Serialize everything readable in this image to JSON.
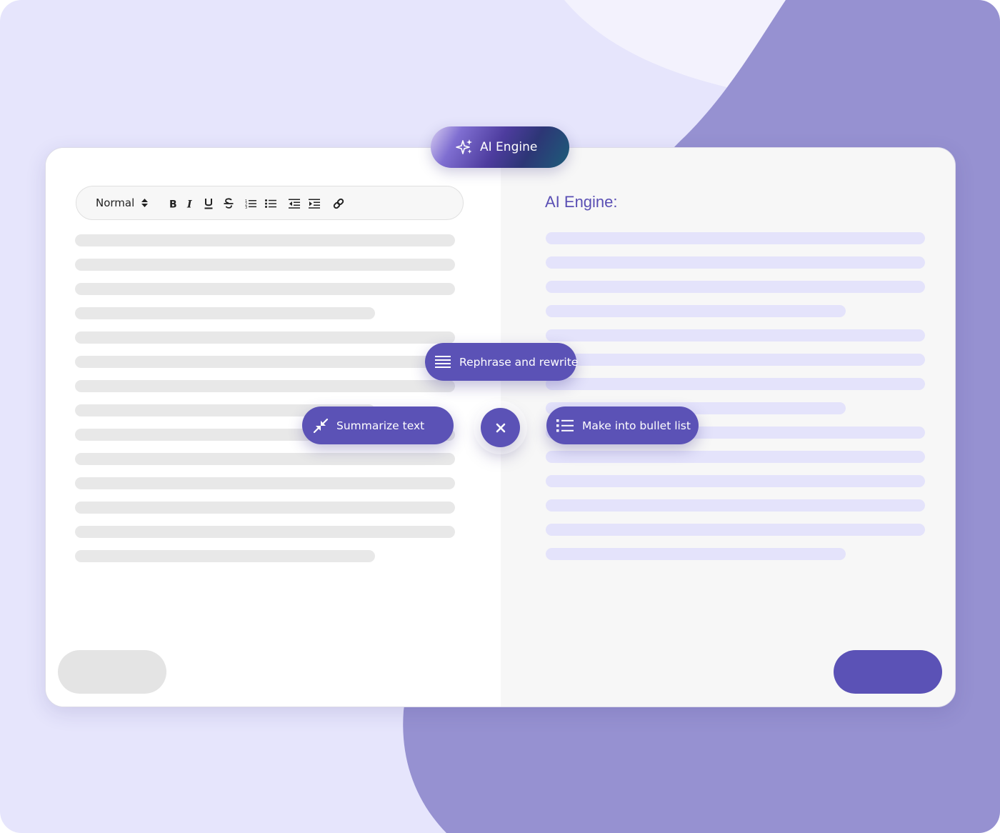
{
  "editor": {
    "format_select": {
      "value": "Normal",
      "icon": "sort-arrows-icon"
    },
    "toolbar_icons": [
      "bold-icon",
      "italic-icon",
      "underline-icon",
      "strikethrough-icon",
      "ordered-list-icon",
      "unordered-list-icon",
      "outdent-icon",
      "indent-icon",
      "link-icon"
    ]
  },
  "badge": {
    "label": "AI Engine",
    "icon": "sparkles-icon"
  },
  "ai_panel": {
    "heading": "AI Engine:"
  },
  "actions": {
    "rephrase": {
      "label": "Rephrase and rewrite",
      "icon": "paragraph-lines-icon"
    },
    "summarize": {
      "label": "Summarize text",
      "icon": "compress-arrows-icon"
    },
    "bullets": {
      "label": "Make into bullet list",
      "icon": "bullet-list-icon"
    },
    "close": {
      "icon": "close-icon"
    }
  },
  "colors": {
    "accent": "#5b52b6",
    "background": "#e6e5fc",
    "blob": "#9691d1",
    "heading": "#5a4fb4"
  }
}
